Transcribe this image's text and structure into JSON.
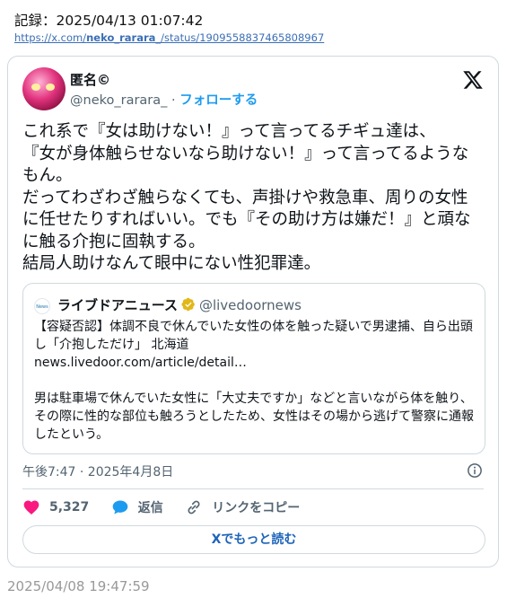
{
  "record_line": "記録：2025/04/13 01:07:42",
  "source_url": {
    "prefix": "https://x.com/",
    "user": "neko_rarara_",
    "suffix": "/status/1909558837465808967"
  },
  "tweet": {
    "author_name": "匿名©",
    "handle": "@neko_rarara_",
    "separator": "·",
    "follow_label": "フォローする",
    "text": "これ系で『女は助けない！』って言ってるチギュ達は、\n『女が身体触らせないなら助けない！』って言ってるようなもん。\nだってわざわざ触らなくても、声掛けや救急車、周りの女性に任せたりすればいい。でも『その助け方は嫌だ！』と頑なに触る介抱に固執する。\n結局人助けなんて眼中にない性犯罪達。",
    "timestamp": "午後7:47 · 2025年4月8日",
    "like_count": "5,327",
    "reply_label": "返信",
    "copy_link_label": "リンクをコピー",
    "read_more_label": "Xでもっと読む"
  },
  "quote": {
    "author_name": "ライブドアニュース",
    "handle": "@livedoornews",
    "avatar_text": "News",
    "text": "【容疑否認】体調不良で休んでいた女性の体を触った疑いで男逮捕、自ら出頭し「介抱しただけ」 北海道\nnews.livedoor.com/article/detail…\n\n男は駐車場で休んでいた女性に「大丈夫ですか」などと言いながら体を触り、その際に性的な部位も触ろうとしたため、女性はその場から逃げて警察に通報したという。"
  },
  "footer_timestamp": "2025/04/08 19:47:59",
  "colors": {
    "accent": "#1d9bf0",
    "like": "#f91880",
    "verified": "#e2b719"
  }
}
